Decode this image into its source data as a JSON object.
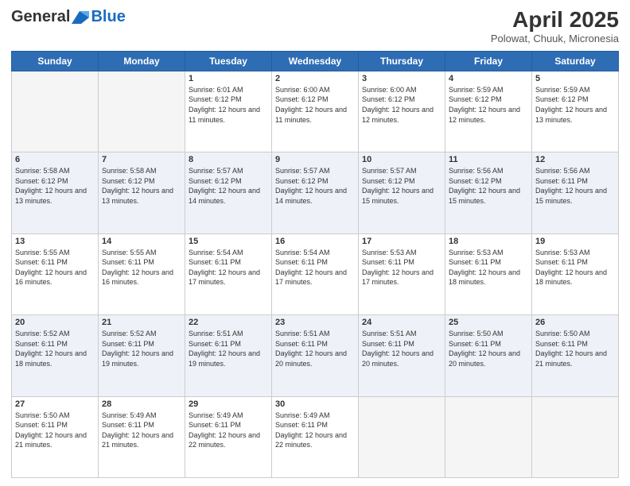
{
  "header": {
    "logo_general": "General",
    "logo_blue": "Blue",
    "title": "April 2025",
    "subtitle": "Polowat, Chuuk, Micronesia"
  },
  "days_of_week": [
    "Sunday",
    "Monday",
    "Tuesday",
    "Wednesday",
    "Thursday",
    "Friday",
    "Saturday"
  ],
  "weeks": [
    [
      {
        "day": "",
        "sunrise": "",
        "sunset": "",
        "daylight": ""
      },
      {
        "day": "",
        "sunrise": "",
        "sunset": "",
        "daylight": ""
      },
      {
        "day": "1",
        "sunrise": "Sunrise: 6:01 AM",
        "sunset": "Sunset: 6:12 PM",
        "daylight": "Daylight: 12 hours and 11 minutes."
      },
      {
        "day": "2",
        "sunrise": "Sunrise: 6:00 AM",
        "sunset": "Sunset: 6:12 PM",
        "daylight": "Daylight: 12 hours and 11 minutes."
      },
      {
        "day": "3",
        "sunrise": "Sunrise: 6:00 AM",
        "sunset": "Sunset: 6:12 PM",
        "daylight": "Daylight: 12 hours and 12 minutes."
      },
      {
        "day": "4",
        "sunrise": "Sunrise: 5:59 AM",
        "sunset": "Sunset: 6:12 PM",
        "daylight": "Daylight: 12 hours and 12 minutes."
      },
      {
        "day": "5",
        "sunrise": "Sunrise: 5:59 AM",
        "sunset": "Sunset: 6:12 PM",
        "daylight": "Daylight: 12 hours and 13 minutes."
      }
    ],
    [
      {
        "day": "6",
        "sunrise": "Sunrise: 5:58 AM",
        "sunset": "Sunset: 6:12 PM",
        "daylight": "Daylight: 12 hours and 13 minutes."
      },
      {
        "day": "7",
        "sunrise": "Sunrise: 5:58 AM",
        "sunset": "Sunset: 6:12 PM",
        "daylight": "Daylight: 12 hours and 13 minutes."
      },
      {
        "day": "8",
        "sunrise": "Sunrise: 5:57 AM",
        "sunset": "Sunset: 6:12 PM",
        "daylight": "Daylight: 12 hours and 14 minutes."
      },
      {
        "day": "9",
        "sunrise": "Sunrise: 5:57 AM",
        "sunset": "Sunset: 6:12 PM",
        "daylight": "Daylight: 12 hours and 14 minutes."
      },
      {
        "day": "10",
        "sunrise": "Sunrise: 5:57 AM",
        "sunset": "Sunset: 6:12 PM",
        "daylight": "Daylight: 12 hours and 15 minutes."
      },
      {
        "day": "11",
        "sunrise": "Sunrise: 5:56 AM",
        "sunset": "Sunset: 6:12 PM",
        "daylight": "Daylight: 12 hours and 15 minutes."
      },
      {
        "day": "12",
        "sunrise": "Sunrise: 5:56 AM",
        "sunset": "Sunset: 6:11 PM",
        "daylight": "Daylight: 12 hours and 15 minutes."
      }
    ],
    [
      {
        "day": "13",
        "sunrise": "Sunrise: 5:55 AM",
        "sunset": "Sunset: 6:11 PM",
        "daylight": "Daylight: 12 hours and 16 minutes."
      },
      {
        "day": "14",
        "sunrise": "Sunrise: 5:55 AM",
        "sunset": "Sunset: 6:11 PM",
        "daylight": "Daylight: 12 hours and 16 minutes."
      },
      {
        "day": "15",
        "sunrise": "Sunrise: 5:54 AM",
        "sunset": "Sunset: 6:11 PM",
        "daylight": "Daylight: 12 hours and 17 minutes."
      },
      {
        "day": "16",
        "sunrise": "Sunrise: 5:54 AM",
        "sunset": "Sunset: 6:11 PM",
        "daylight": "Daylight: 12 hours and 17 minutes."
      },
      {
        "day": "17",
        "sunrise": "Sunrise: 5:53 AM",
        "sunset": "Sunset: 6:11 PM",
        "daylight": "Daylight: 12 hours and 17 minutes."
      },
      {
        "day": "18",
        "sunrise": "Sunrise: 5:53 AM",
        "sunset": "Sunset: 6:11 PM",
        "daylight": "Daylight: 12 hours and 18 minutes."
      },
      {
        "day": "19",
        "sunrise": "Sunrise: 5:53 AM",
        "sunset": "Sunset: 6:11 PM",
        "daylight": "Daylight: 12 hours and 18 minutes."
      }
    ],
    [
      {
        "day": "20",
        "sunrise": "Sunrise: 5:52 AM",
        "sunset": "Sunset: 6:11 PM",
        "daylight": "Daylight: 12 hours and 18 minutes."
      },
      {
        "day": "21",
        "sunrise": "Sunrise: 5:52 AM",
        "sunset": "Sunset: 6:11 PM",
        "daylight": "Daylight: 12 hours and 19 minutes."
      },
      {
        "day": "22",
        "sunrise": "Sunrise: 5:51 AM",
        "sunset": "Sunset: 6:11 PM",
        "daylight": "Daylight: 12 hours and 19 minutes."
      },
      {
        "day": "23",
        "sunrise": "Sunrise: 5:51 AM",
        "sunset": "Sunset: 6:11 PM",
        "daylight": "Daylight: 12 hours and 20 minutes."
      },
      {
        "day": "24",
        "sunrise": "Sunrise: 5:51 AM",
        "sunset": "Sunset: 6:11 PM",
        "daylight": "Daylight: 12 hours and 20 minutes."
      },
      {
        "day": "25",
        "sunrise": "Sunrise: 5:50 AM",
        "sunset": "Sunset: 6:11 PM",
        "daylight": "Daylight: 12 hours and 20 minutes."
      },
      {
        "day": "26",
        "sunrise": "Sunrise: 5:50 AM",
        "sunset": "Sunset: 6:11 PM",
        "daylight": "Daylight: 12 hours and 21 minutes."
      }
    ],
    [
      {
        "day": "27",
        "sunrise": "Sunrise: 5:50 AM",
        "sunset": "Sunset: 6:11 PM",
        "daylight": "Daylight: 12 hours and 21 minutes."
      },
      {
        "day": "28",
        "sunrise": "Sunrise: 5:49 AM",
        "sunset": "Sunset: 6:11 PM",
        "daylight": "Daylight: 12 hours and 21 minutes."
      },
      {
        "day": "29",
        "sunrise": "Sunrise: 5:49 AM",
        "sunset": "Sunset: 6:11 PM",
        "daylight": "Daylight: 12 hours and 22 minutes."
      },
      {
        "day": "30",
        "sunrise": "Sunrise: 5:49 AM",
        "sunset": "Sunset: 6:11 PM",
        "daylight": "Daylight: 12 hours and 22 minutes."
      },
      {
        "day": "",
        "sunrise": "",
        "sunset": "",
        "daylight": ""
      },
      {
        "day": "",
        "sunrise": "",
        "sunset": "",
        "daylight": ""
      },
      {
        "day": "",
        "sunrise": "",
        "sunset": "",
        "daylight": ""
      }
    ]
  ]
}
